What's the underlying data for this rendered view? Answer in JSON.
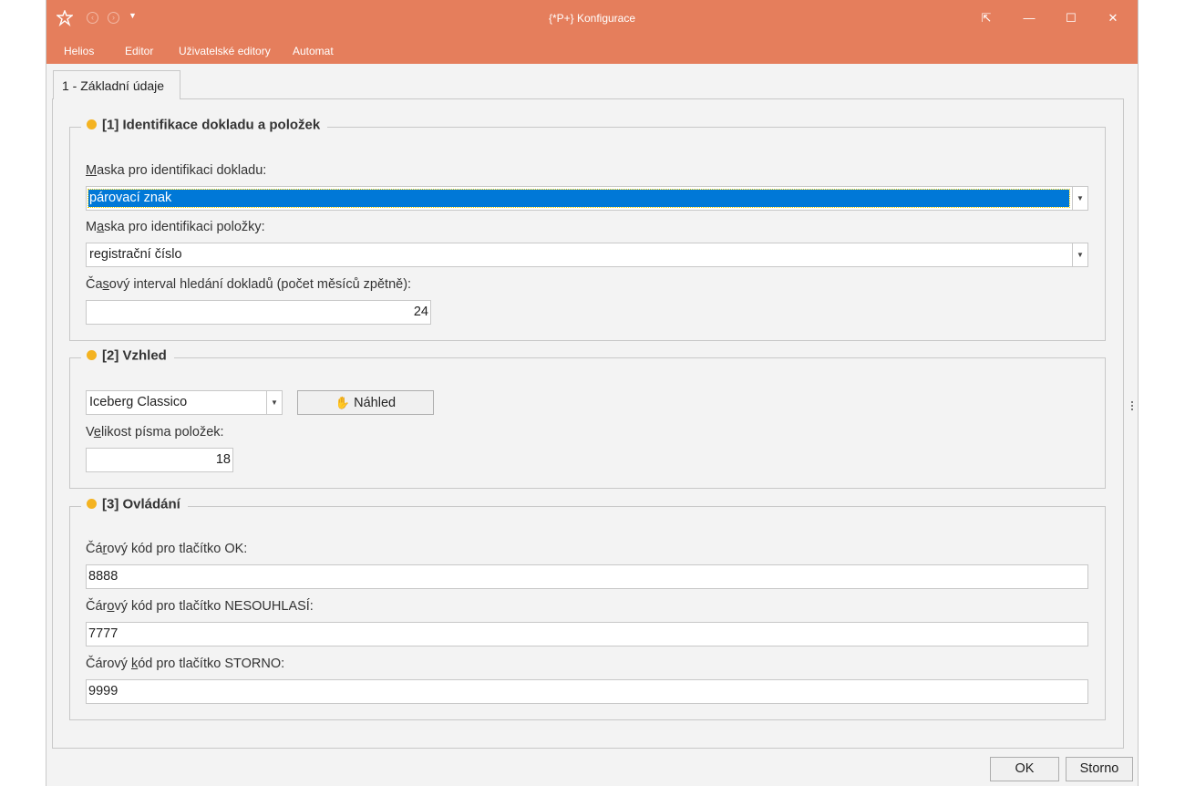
{
  "window": {
    "title": "{*P+} Konfigurace",
    "controls": {
      "pin": "⇱",
      "minimize": "—",
      "maximize": "☐",
      "close": "✕"
    }
  },
  "menu": {
    "items": [
      "Helios",
      "Editor",
      "Uživatelské editory",
      "Automat"
    ]
  },
  "tabs": [
    {
      "label": "1 - Základní údaje"
    }
  ],
  "sections": {
    "identification": {
      "title": "[1] Identifikace dokladu a položek",
      "doc_mask_label_hot": "M",
      "doc_mask_label_rest": "aska pro identifikaci dokladu:",
      "doc_mask_value": "párovací znak",
      "item_mask_label_pre": "M",
      "item_mask_label_hot": "a",
      "item_mask_label_rest": "ska pro identifikaci položky:",
      "item_mask_value": "registrační číslo",
      "interval_label_pre": "Ča",
      "interval_label_hot": "s",
      "interval_label_rest": "ový interval hledání dokladů (počet měsíců zpětně):",
      "interval_value": "24"
    },
    "appearance": {
      "title": "[2] Vzhled",
      "theme_value": "Iceberg Classico",
      "preview_button": "Náhled",
      "font_size_label_pre": "V",
      "font_size_label_hot": "e",
      "font_size_label_rest": "likost písma položek:",
      "font_size_value": "18"
    },
    "controls": {
      "title": "[3] Ovládání",
      "ok_label_pre": "Čá",
      "ok_label_hot": "r",
      "ok_label_rest": "ový kód pro tlačítko OK:",
      "ok_value": "8888",
      "nesouhlasi_label_pre": "Čár",
      "nesouhlasi_label_hot": "o",
      "nesouhlasi_label_rest": "vý kód pro tlačítko NESOUHLASÍ:",
      "nesouhlasi_value": "7777",
      "storno_label_pre": "Čárový ",
      "storno_label_hot": "k",
      "storno_label_rest": "ód pro tlačítko STORNO:",
      "storno_value": "9999"
    }
  },
  "footer": {
    "ok": "OK",
    "cancel": "Storno"
  },
  "colors": {
    "titlebar": "#e57e5c",
    "accent_dot": "#f4b321",
    "selection": "#0078d7"
  }
}
